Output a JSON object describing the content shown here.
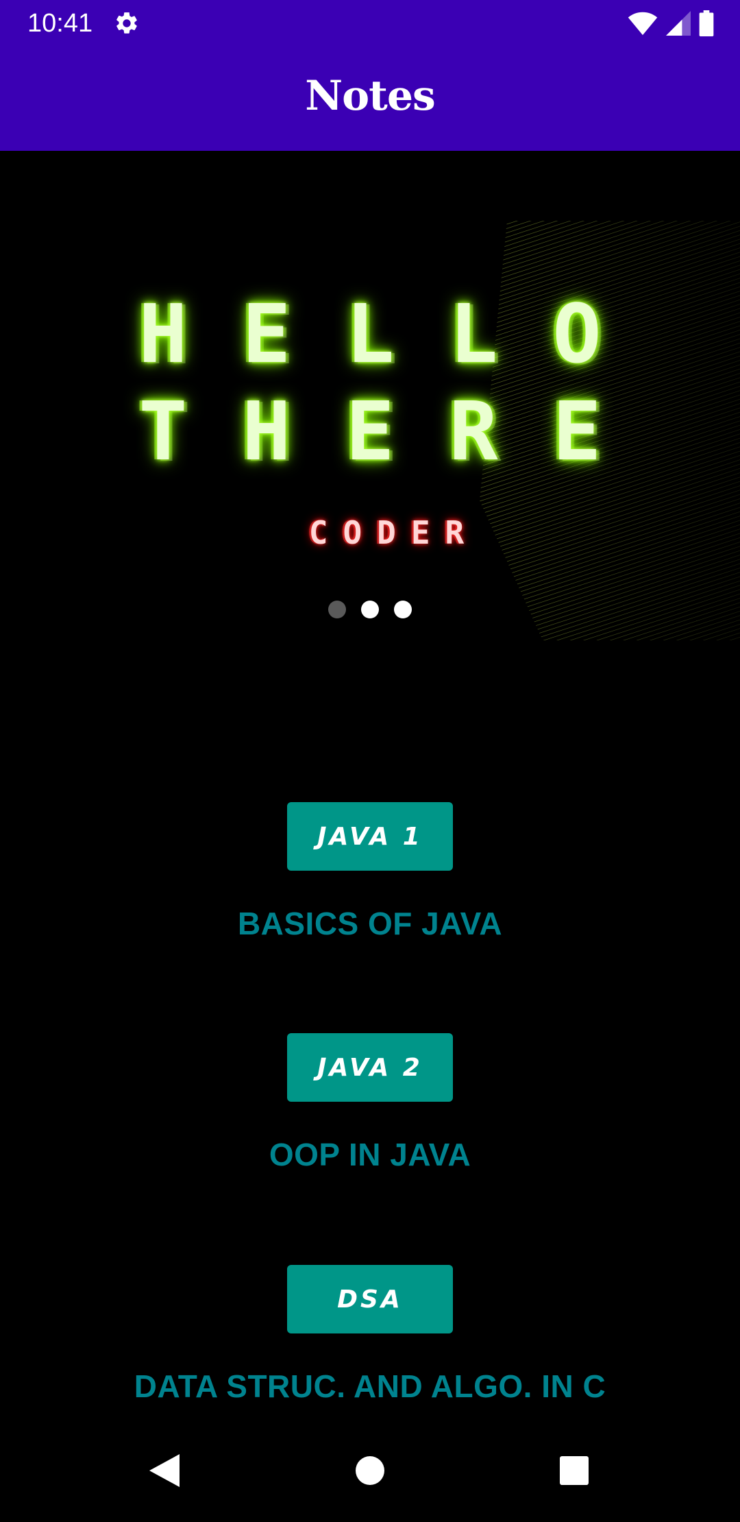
{
  "status_bar": {
    "time": "10:41",
    "icons": [
      "gear-icon",
      "wifi-icon",
      "signal-icon",
      "battery-icon"
    ]
  },
  "app_bar": {
    "title": "Notes"
  },
  "banner": {
    "line1": "HELLO",
    "line2": "THERE",
    "line3": "CODER",
    "glow_color": "#8cff00",
    "accent_color": "#ff2b2b",
    "carousel": {
      "total": 3,
      "active_index": 0
    }
  },
  "courses": [
    {
      "button": "JAVA 1",
      "description": "BASICS OF JAVA"
    },
    {
      "button": "JAVA 2",
      "description": "OOP IN JAVA"
    },
    {
      "button": "DSA",
      "description": "DATA STRUC. AND ALGO. IN C"
    }
  ],
  "colors": {
    "app_bar": "#3b00b4",
    "button": "#009688",
    "description": "#00838f",
    "background": "#000000"
  },
  "nav_bar": {
    "icons": [
      "back-icon",
      "home-icon",
      "recents-icon"
    ]
  }
}
